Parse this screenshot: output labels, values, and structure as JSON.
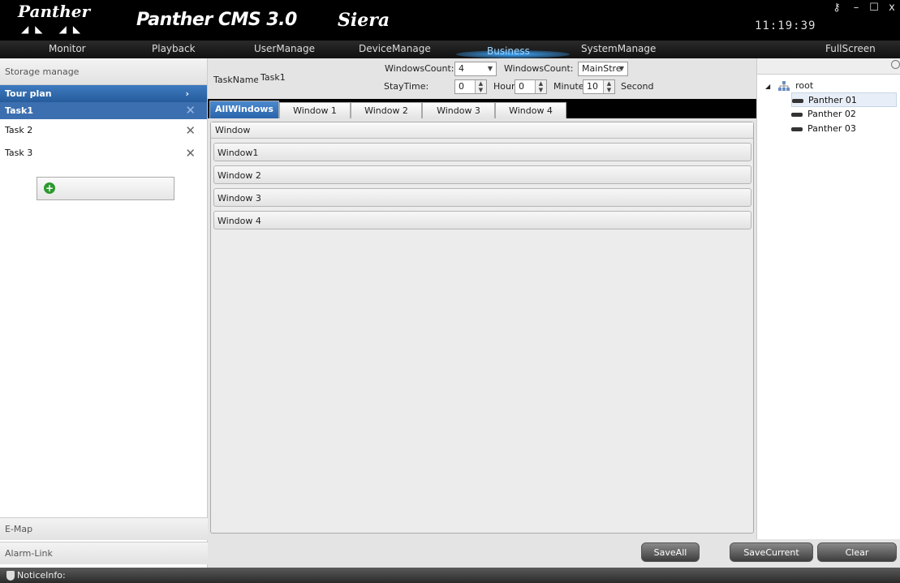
{
  "header": {
    "logo_text": "Panther",
    "app_title": "Panther CMS 3.0",
    "brand": "Siera",
    "clock": "11:19:39"
  },
  "menu": {
    "items": [
      "Monitor",
      "Playback",
      "UserManage",
      "DeviceManage",
      "Business",
      "SystemManage",
      "FullScreen"
    ],
    "active": "Business"
  },
  "sidebar": {
    "header": "Storage manage",
    "section": "Tour plan",
    "tasks": [
      "Task1",
      "Task 2",
      "Task 3"
    ],
    "selected_task": "Task1",
    "bottom": [
      "E-Map",
      "Alarm-Link"
    ]
  },
  "form": {
    "taskname_label": "TaskName:",
    "taskname_value": "Task1",
    "windows_count_label": "WindowsCount:",
    "windows_count_value": "4",
    "stream_label": "WindowsCount:",
    "stream_value": "MainStre",
    "staytime_label": "StayTime:",
    "hour_value": "0",
    "hour_label": "Hour",
    "minute_value": "0",
    "minute_label": "Minute",
    "second_value": "10",
    "second_label": "Second"
  },
  "tabs": [
    "AllWindows",
    "Window 1",
    "Window 2",
    "Window 3",
    "Window 4"
  ],
  "active_tab": "AllWindows",
  "window_list": {
    "header": "Window",
    "rows": [
      "Window1",
      "Window 2",
      "Window 3",
      "Window 4"
    ]
  },
  "device_tree": {
    "root": "root",
    "devices": [
      "Panther 01",
      "Panther 02",
      "Panther 03"
    ],
    "selected": "Panther 01"
  },
  "actions": {
    "save_all": "SaveAll",
    "save_current": "SaveCurrent",
    "clear": "Clear"
  },
  "status": {
    "notice": "NoticeInfo:"
  }
}
